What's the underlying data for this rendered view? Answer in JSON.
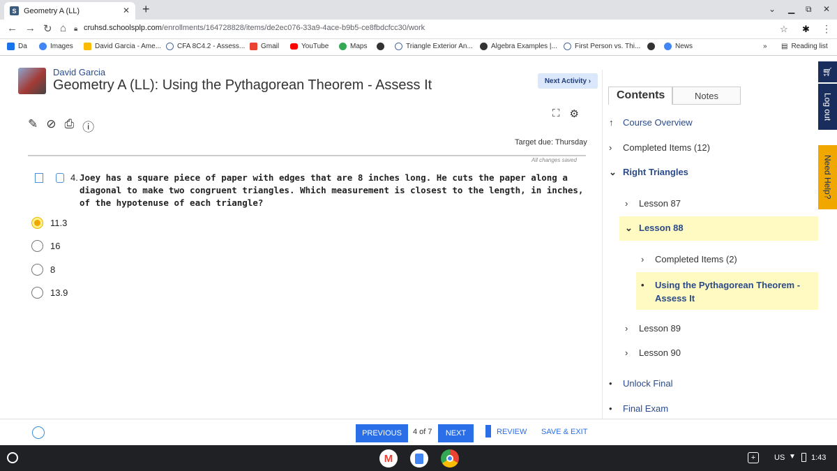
{
  "browser": {
    "tab_title": "Geometry A (LL)",
    "tab_favicon": "S",
    "url_domain": "cruhsd.schoolsplp.com",
    "url_path": "/enrollments/164728828/items/de2ec076-33a9-4ace-b9b5-ce8fbdcfcc30/work",
    "bookmarks": [
      {
        "label": "Da",
        "icon": "apps-icon",
        "color": "#1a73e8"
      },
      {
        "label": "Images",
        "icon": "google-icon",
        "color": "#4285f4"
      },
      {
        "label": "David Garcia - Ame...",
        "icon": "folder-icon",
        "color": "#fbbc04"
      },
      {
        "label": "CFA 8C4.2 - Assess...",
        "icon": "s-icon",
        "color": "#4a6a9a"
      },
      {
        "label": "Gmail",
        "icon": "gmail-icon",
        "color": "#ea4335"
      },
      {
        "label": "YouTube",
        "icon": "youtube-icon",
        "color": "#ff0000"
      },
      {
        "label": "Maps",
        "icon": "maps-icon",
        "color": "#34a853"
      },
      {
        "label": "",
        "icon": "globe-icon",
        "color": "#333"
      },
      {
        "label": "Triangle Exterior An...",
        "icon": "s-icon",
        "color": "#4a6a9a"
      },
      {
        "label": "Algebra Examples |...",
        "icon": "globe-icon",
        "color": "#333"
      },
      {
        "label": "First Person vs. Thi...",
        "icon": "s-icon",
        "color": "#4a6a9a"
      },
      {
        "label": "",
        "icon": "globe-icon",
        "color": "#333"
      },
      {
        "label": "News",
        "icon": "news-icon",
        "color": "#4285f4"
      }
    ],
    "reading_list": "Reading list",
    "overflow": "»"
  },
  "header": {
    "student_name": "David Garcia",
    "course_title": "Geometry A (LL): Using the Pythagorean Theorem - Assess It",
    "next_activity": "Next Activity ›",
    "target_due": "Target due: Thursday",
    "saved_status": "All changes saved"
  },
  "question": {
    "number": "4.",
    "text": "Joey has a square piece of paper with edges that are 8 inches long. He cuts the paper along a diagonal to make two congruent triangles. Which measurement is closest to the length, in inches, of the hypotenuse of each triangle?",
    "options": [
      {
        "label": "11.3",
        "selected": true
      },
      {
        "label": "16",
        "selected": false
      },
      {
        "label": "8",
        "selected": false
      },
      {
        "label": "13.9",
        "selected": false
      }
    ]
  },
  "sidebar": {
    "tab_contents": "Contents",
    "tab_notes": "Notes",
    "course_overview": "Course Overview",
    "completed_items": "Completed Items (12)",
    "unit": "Right Triangles",
    "lesson87": "Lesson 87",
    "lesson88": "Lesson 88",
    "lesson88_completed": "Completed Items (2)",
    "current_item_line1": "Using the Pythagorean Theorem -",
    "current_item_line2": "Assess It",
    "lesson89": "Lesson 89",
    "lesson90": "Lesson 90",
    "unlock_final": "Unlock Final",
    "final_exam": "Final Exam"
  },
  "strip": {
    "log_out": "Log out",
    "need_help": "Need Help?"
  },
  "footer": {
    "previous": "PREVIOUS",
    "page_counter": "4 of 7",
    "next": "NEXT",
    "review": "REVIEW",
    "save_exit": "SAVE & EXIT"
  },
  "shelf": {
    "locale": "US",
    "time": "1:43"
  }
}
